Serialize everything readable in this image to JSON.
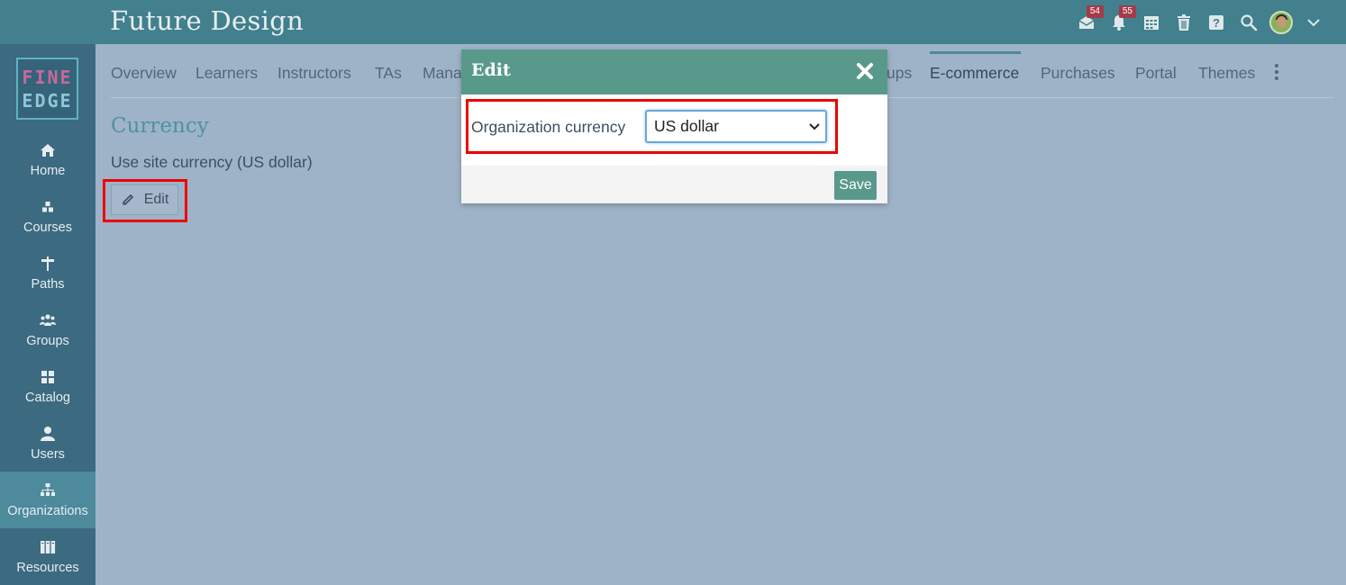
{
  "header": {
    "title": "Future Design",
    "icons": [
      {
        "name": "messages-icon",
        "badge": "54"
      },
      {
        "name": "notifications-icon",
        "badge": "55"
      },
      {
        "name": "calendar-icon"
      },
      {
        "name": "trash-icon"
      },
      {
        "name": "help-icon"
      },
      {
        "name": "search-icon"
      },
      {
        "name": "avatar"
      },
      {
        "name": "chevron-down-icon"
      }
    ]
  },
  "sidebar": {
    "logo": {
      "line1": "FINE",
      "line2": "EDGE"
    },
    "items": [
      {
        "label": "Home",
        "icon": "home-icon"
      },
      {
        "label": "Courses",
        "icon": "courses-icon"
      },
      {
        "label": "Paths",
        "icon": "paths-icon"
      },
      {
        "label": "Groups",
        "icon": "groups-icon"
      },
      {
        "label": "Catalog",
        "icon": "catalog-icon"
      },
      {
        "label": "Users",
        "icon": "user-icon"
      },
      {
        "label": "Organizations",
        "icon": "organizations-icon",
        "active": true
      },
      {
        "label": "Resources",
        "icon": "resources-icon"
      }
    ]
  },
  "tabs": {
    "items": [
      "Overview",
      "Learners",
      "Instructors",
      "TAs",
      "Mana",
      "ups",
      "E-commerce",
      "Purchases",
      "Portal",
      "Themes"
    ],
    "active": "E-commerce"
  },
  "main": {
    "section_title": "Currency",
    "site_currency_text": "Use site currency (US dollar)",
    "edit_button_label": "Edit"
  },
  "modal": {
    "title": "Edit",
    "field_label": "Organization currency",
    "currency_value": "US dollar",
    "save_label": "Save"
  },
  "colors": {
    "topbar": "#41808c",
    "sidebar": "#3c6a80",
    "overlay": "#9fb3c8",
    "modal_header": "#58998c",
    "highlight": "#ee0000"
  }
}
